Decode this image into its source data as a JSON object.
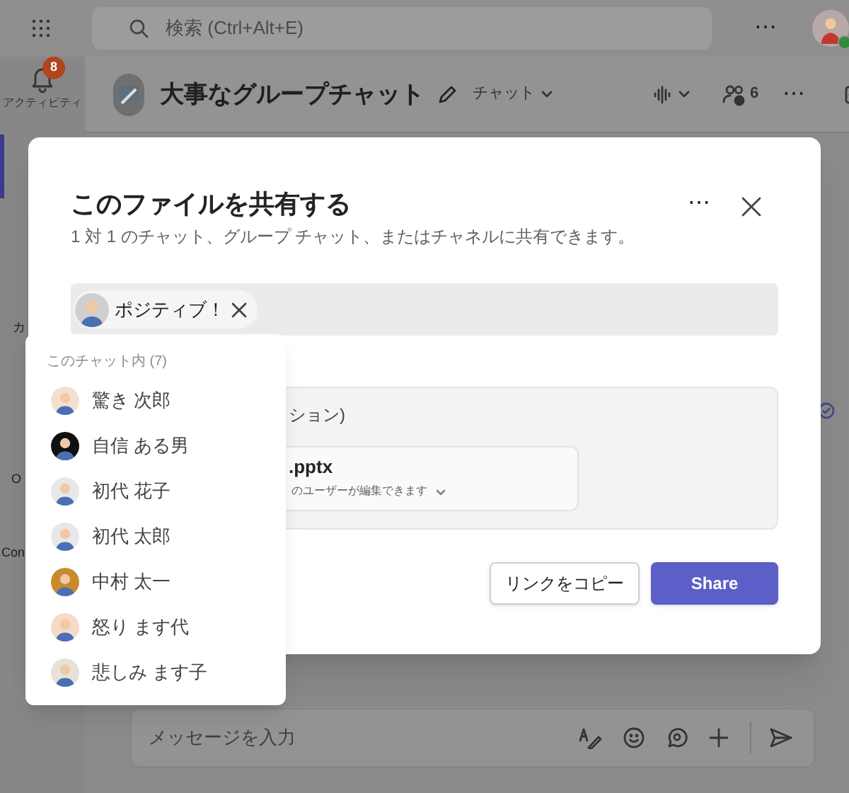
{
  "top_bar": {
    "search_placeholder": "検索 (Ctrl+Alt+E)",
    "more": "⋯"
  },
  "rail": {
    "activity": {
      "label": "アクティビティ",
      "badge": "8"
    },
    "fragments": [
      "カ",
      "O",
      "Con"
    ]
  },
  "chat_header": {
    "title": "大事なグループチャット",
    "tab": "チャット",
    "participants": "6",
    "more": "⋯"
  },
  "dialog": {
    "title": "このファイルを共有する",
    "subtitle": "1 対 1 のチャット、グループ チャット、またはチャネルに共有できます。",
    "more": "⋯",
    "recipients": [
      {
        "name": "ポジティブ！"
      }
    ],
    "section_label": "ション)",
    "file_name": ".pptx",
    "permission": "のユーザーが編集できます",
    "buttons": [
      {
        "label": "リンクをコピー",
        "kind": "secondary"
      },
      {
        "label": "Share",
        "kind": "primary"
      }
    ]
  },
  "suggestions": {
    "heading": "このチャット内 (7)",
    "people": [
      {
        "name": "驚き 次郎"
      },
      {
        "name": "自信 ある男"
      },
      {
        "name": "初代 花子"
      },
      {
        "name": "初代 太郎"
      },
      {
        "name": "中村 太一"
      },
      {
        "name": "怒り ます代"
      },
      {
        "name": "悲しみ ます子"
      }
    ]
  },
  "composer": {
    "placeholder": "メッセージを入力"
  }
}
